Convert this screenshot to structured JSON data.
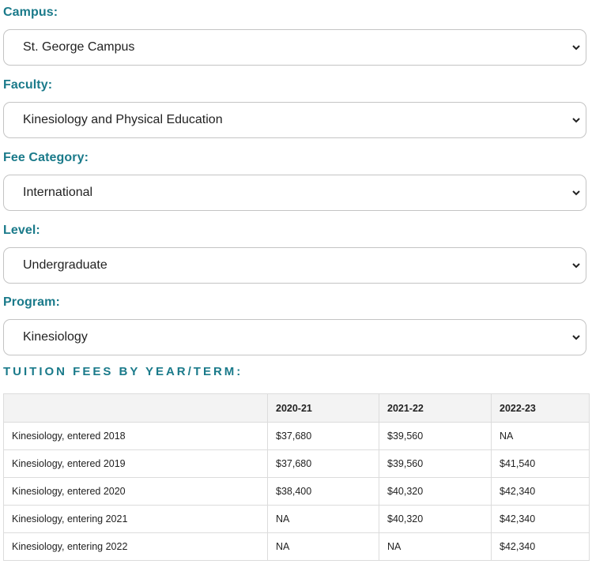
{
  "filters": [
    {
      "label": "Campus:",
      "value": "St. George Campus"
    },
    {
      "label": "Faculty:",
      "value": "Kinesiology and Physical Education"
    },
    {
      "label": "Fee Category:",
      "value": "International"
    },
    {
      "label": "Level:",
      "value": "Undergraduate"
    },
    {
      "label": "Program:",
      "value": "Kinesiology"
    }
  ],
  "section_title": "TUITION FEES BY YEAR/TERM:",
  "table": {
    "headers": [
      "",
      "2020-21",
      "2021-22",
      "2022-23"
    ],
    "rows": [
      [
        "Kinesiology, entered 2018",
        "$37,680",
        "$39,560",
        "NA"
      ],
      [
        "Kinesiology, entered 2019",
        "$37,680",
        "$39,560",
        "$41,540"
      ],
      [
        "Kinesiology, entered 2020",
        "$38,400",
        "$40,320",
        "$42,340"
      ],
      [
        "Kinesiology, entering 2021",
        "NA",
        "$40,320",
        "$42,340"
      ],
      [
        "Kinesiology, entering 2022",
        "NA",
        "NA",
        "$42,340"
      ]
    ]
  },
  "colors": {
    "label": "#1a7a8a",
    "header_bg": "#f3f3f3",
    "border": "#c4c4c4"
  },
  "icons": {
    "select_arrow": "chevron-down-icon"
  }
}
